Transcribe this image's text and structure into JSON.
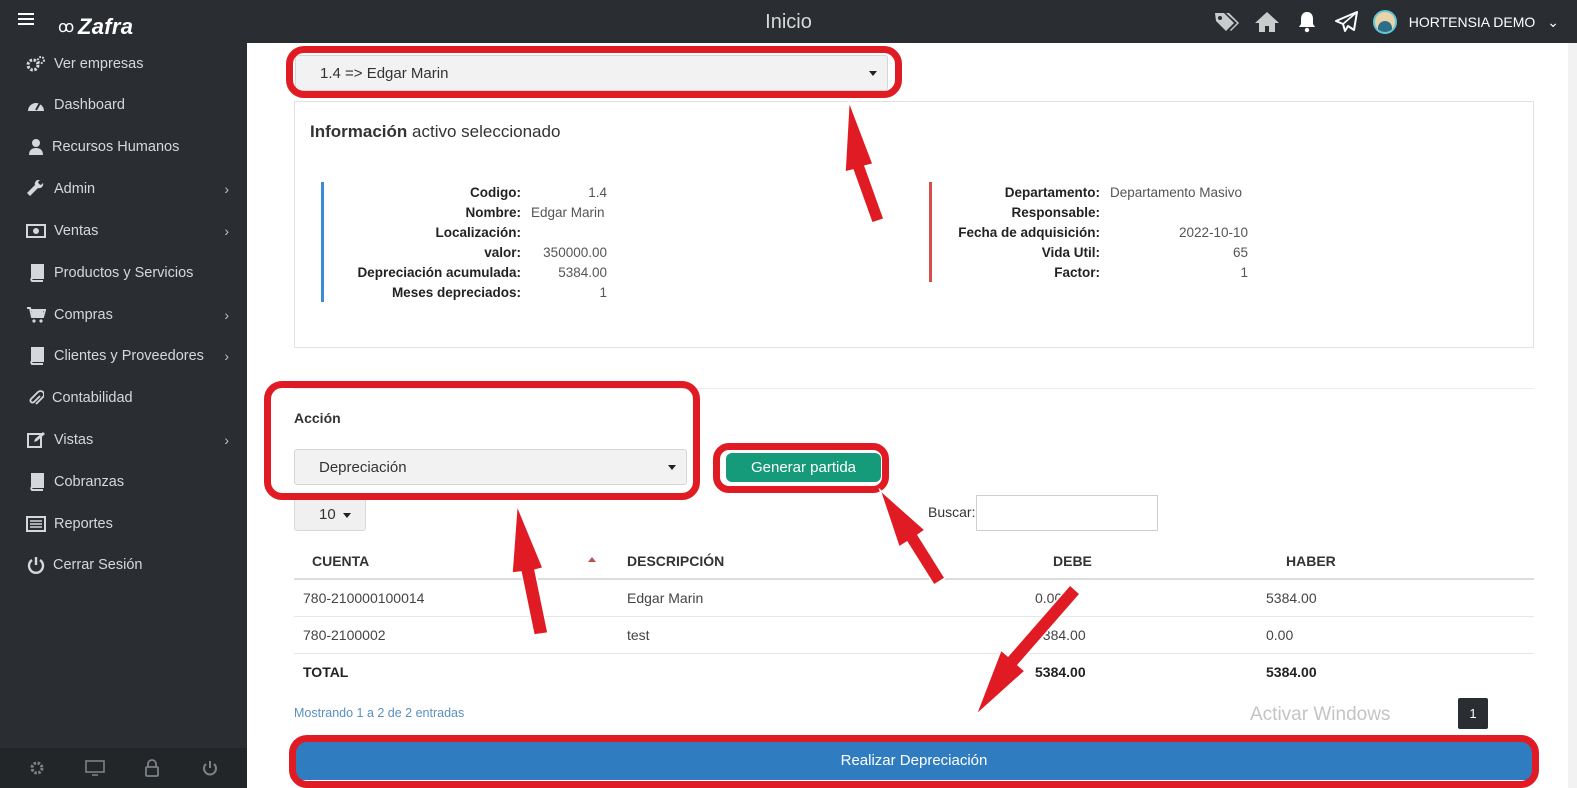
{
  "topbar": {
    "brand": "Zafra",
    "page_title": "Inicio",
    "user_name": "HORTENSIA DEMO"
  },
  "sidebar": {
    "items": [
      {
        "label": "Ver empresas",
        "icon": "gears-icon",
        "has_submenu": false
      },
      {
        "label": "Dashboard",
        "icon": "dashboard-icon",
        "has_submenu": false
      },
      {
        "label": "Recursos Humanos",
        "icon": "user-icon",
        "has_submenu": false
      },
      {
        "label": "Admin",
        "icon": "wrench-icon",
        "has_submenu": true
      },
      {
        "label": "Ventas",
        "icon": "money-icon",
        "has_submenu": true
      },
      {
        "label": "Productos y Servicios",
        "icon": "book-icon",
        "has_submenu": false
      },
      {
        "label": "Compras",
        "icon": "cart-icon",
        "has_submenu": true
      },
      {
        "label": "Clientes y Proveedores",
        "icon": "book-icon",
        "has_submenu": true
      },
      {
        "label": "Contabilidad",
        "icon": "paperclip-icon",
        "has_submenu": false
      },
      {
        "label": "Vistas",
        "icon": "edit-icon",
        "has_submenu": true
      },
      {
        "label": "Cobranzas",
        "icon": "book-icon",
        "has_submenu": false
      },
      {
        "label": "Reportes",
        "icon": "list-icon",
        "has_submenu": false
      },
      {
        "label": "Cerrar Sesión",
        "icon": "power-icon",
        "has_submenu": false
      }
    ]
  },
  "asset": {
    "selected": "1.4 => Edgar Marin"
  },
  "info": {
    "title_bold": "Información",
    "title_rest": "activo seleccionado",
    "left": [
      {
        "label": "Codigo:",
        "value": "1.4"
      },
      {
        "label": "Nombre:",
        "value": "Edgar Marin"
      },
      {
        "label": "Localización:",
        "value": ""
      },
      {
        "label": "valor:",
        "value": "350000.00"
      },
      {
        "label": "Depreciación acumulada:",
        "value": "5384.00"
      },
      {
        "label": "Meses depreciados:",
        "value": "1"
      }
    ],
    "right": [
      {
        "label": "Departamento:",
        "value": "Departamento Masivo"
      },
      {
        "label": "Responsable:",
        "value": ""
      },
      {
        "label": "Fecha de adquisición:",
        "value": "2022-10-10"
      },
      {
        "label": "Vida Util:",
        "value": "65"
      },
      {
        "label": "Factor:",
        "value": "1"
      }
    ]
  },
  "accion": {
    "label": "Acción",
    "selected": "Depreciación",
    "generate_button": "Generar partida"
  },
  "table_controls": {
    "page_length": "10",
    "search_label": "Buscar:",
    "search_value": ""
  },
  "table": {
    "headers": [
      "CUENTA",
      "DESCRIPCIÓN",
      "DEBE",
      "HABER"
    ],
    "rows": [
      [
        "780-210000100014",
        "Edgar Marin",
        "0.00",
        "5384.00"
      ],
      [
        "780-2100002",
        "test",
        "5384.00",
        "0.00"
      ]
    ],
    "total": {
      "label": "TOTAL",
      "debe": "5384.00",
      "haber": "5384.00"
    }
  },
  "footer": {
    "showing": "Mostrando 1 a 2 de 2 entradas",
    "watermark": "Activar Windows",
    "page": "1",
    "submit_button": "Realizar Depreciación"
  },
  "colors": {
    "sidebar_bg": "#2a2e33",
    "accent_green": "#159a7a",
    "accent_blue": "#2f7dc0",
    "annotation_red": "#e01b24"
  }
}
